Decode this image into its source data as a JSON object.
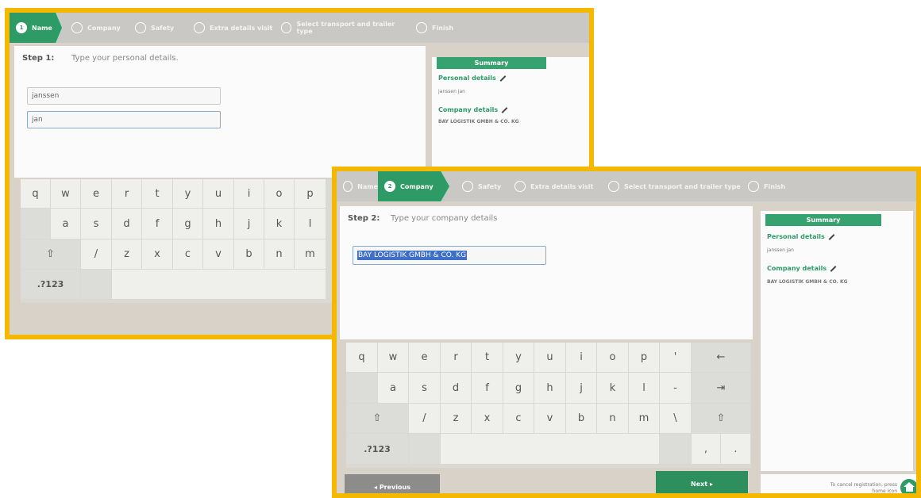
{
  "screen1": {
    "steps": [
      {
        "num": "1",
        "label": "Name",
        "active": true
      },
      {
        "num": "",
        "label": "Company",
        "active": false
      },
      {
        "num": "",
        "label": "Safety",
        "active": false
      },
      {
        "num": "",
        "label": "Extra details visit",
        "active": false
      },
      {
        "num": "",
        "label": "Select transport and trailer type",
        "active": false
      },
      {
        "num": "",
        "label": "Finish",
        "active": false
      }
    ],
    "step_label": "Step 1:",
    "step_desc": "Type your personal details.",
    "fields": {
      "lastname": "janssen",
      "firstname": "jan"
    },
    "summary": {
      "title": "Summary",
      "personal_title": "Personal details",
      "personal_value": "janssen jan",
      "company_title": "Company details",
      "company_value": "BAY LOGISTIK GMBH & CO. KG"
    },
    "keyboard": {
      "row1": [
        "q",
        "w",
        "e",
        "r",
        "t",
        "y",
        "u",
        "i",
        "o",
        "p"
      ],
      "row2": [
        "a",
        "s",
        "d",
        "f",
        "g",
        "h",
        "j",
        "k",
        "l"
      ],
      "row3": [
        "/",
        "z",
        "x",
        "c",
        "v",
        "b",
        "n",
        "m"
      ],
      "shift": "⇧",
      "symbols": ".?123"
    }
  },
  "screen2": {
    "steps": [
      {
        "num": "",
        "label": "Name",
        "active": false
      },
      {
        "num": "2",
        "label": "Company",
        "active": true
      },
      {
        "num": "",
        "label": "Safety",
        "active": false
      },
      {
        "num": "",
        "label": "Extra details visit",
        "active": false
      },
      {
        "num": "",
        "label": "Select transport and trailer type",
        "active": false
      },
      {
        "num": "",
        "label": "Finish",
        "active": false
      }
    ],
    "step_label": "Step 2:",
    "step_desc": "Type your company details",
    "fields": {
      "company": "BAY LOGISTIK GMBH & CO. KG"
    },
    "summary": {
      "title": "Summary",
      "personal_title": "Personal details",
      "personal_value": "janssen jan",
      "company_title": "Company details",
      "company_value": "BAY LOGISTIK GMBH & CO. KG"
    },
    "keyboard": {
      "row1": [
        "q",
        "w",
        "e",
        "r",
        "t",
        "y",
        "u",
        "i",
        "o",
        "p",
        "'"
      ],
      "row2": [
        "a",
        "s",
        "d",
        "f",
        "g",
        "h",
        "j",
        "k",
        "l",
        "-"
      ],
      "row3": [
        "/",
        "z",
        "x",
        "c",
        "v",
        "b",
        "n",
        "m",
        "\\"
      ],
      "backspace": "←",
      "tab": "⇥",
      "shift": "⇧",
      "symbols": ".?123",
      "comma": ",",
      "period": "."
    },
    "buttons": {
      "previous": "◂ Previous",
      "next": "Next ▸"
    },
    "cancel_text": "To cancel registration, press home icon"
  },
  "colors": {
    "accent": "#2e9a66",
    "highlight": "#f5b800",
    "selection": "#3f6fc6"
  }
}
